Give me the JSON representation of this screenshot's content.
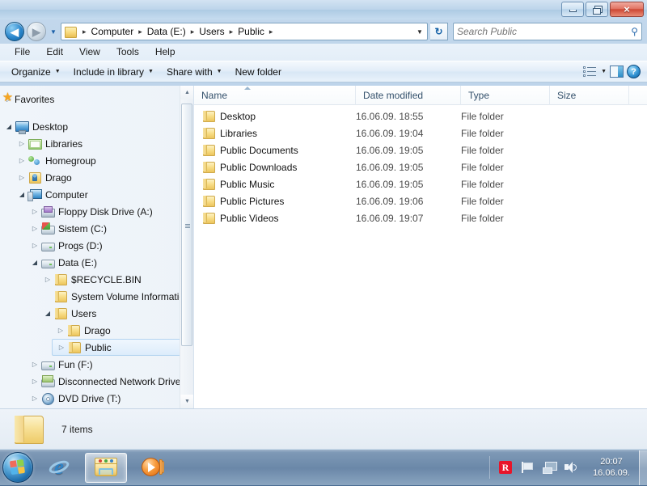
{
  "window": {
    "controls": {
      "minimize": "minimize-button",
      "maximize": "restore-button",
      "close": "×"
    }
  },
  "address": {
    "back_glyph": "◀",
    "forward_glyph": "▶",
    "history_glyph": "▼",
    "folder_icon": "folder-icon",
    "breadcrumbs": [
      "Computer",
      "Data (E:)",
      "Users",
      "Public"
    ],
    "separator": "▸",
    "dropdown_glyph": "▼",
    "refresh_glyph": "↻",
    "search_placeholder": "Search Public",
    "search_value": "",
    "search_icon": "search-icon"
  },
  "menubar": {
    "items": [
      "File",
      "Edit",
      "View",
      "Tools",
      "Help"
    ]
  },
  "toolbar": {
    "items": [
      {
        "label": "Organize",
        "has_caret": true
      },
      {
        "label": "Include in library",
        "has_caret": true
      },
      {
        "label": "Share with",
        "has_caret": true
      },
      {
        "label": "New folder",
        "has_caret": false
      }
    ],
    "caret_glyph": "▼",
    "view_icon": "view-options-icon",
    "layout_icon": "preview-pane-icon",
    "help_icon": "?"
  },
  "nav_pane": {
    "items": [
      {
        "label": "Favorites",
        "icon": "star-icon",
        "indent": 0,
        "expander": "collapsed",
        "selected": false,
        "spacer_after": true
      },
      {
        "label": "Desktop",
        "icon": "monitor-icon",
        "indent": 0,
        "expander": "expanded",
        "selected": false
      },
      {
        "label": "Libraries",
        "icon": "libraries-icon",
        "indent": 1,
        "expander": "collapsed",
        "selected": false
      },
      {
        "label": "Homegroup",
        "icon": "homegroup-icon",
        "indent": 1,
        "expander": "collapsed",
        "selected": false
      },
      {
        "label": "Drago",
        "icon": "user-folder-icon",
        "indent": 1,
        "expander": "collapsed",
        "selected": false
      },
      {
        "label": "Computer",
        "icon": "computer-icon",
        "indent": 1,
        "expander": "expanded",
        "selected": false
      },
      {
        "label": "Floppy Disk Drive (A:)",
        "icon": "floppy-drive-icon",
        "indent": 2,
        "expander": "collapsed",
        "selected": false
      },
      {
        "label": "Sistem (C:)",
        "icon": "system-drive-icon",
        "indent": 2,
        "expander": "collapsed",
        "selected": false
      },
      {
        "label": "Progs (D:)",
        "icon": "drive-icon",
        "indent": 2,
        "expander": "collapsed",
        "selected": false
      },
      {
        "label": "Data (E:)",
        "icon": "drive-icon",
        "indent": 2,
        "expander": "expanded",
        "selected": false
      },
      {
        "label": "$RECYCLE.BIN",
        "icon": "folder-icon",
        "indent": 3,
        "expander": "collapsed",
        "selected": false
      },
      {
        "label": "System Volume Information",
        "icon": "folder-icon",
        "indent": 3,
        "expander": "none",
        "selected": false
      },
      {
        "label": "Users",
        "icon": "folder-icon",
        "indent": 3,
        "expander": "expanded",
        "selected": false
      },
      {
        "label": "Drago",
        "icon": "folder-icon",
        "indent": 4,
        "expander": "collapsed",
        "selected": false
      },
      {
        "label": "Public",
        "icon": "folder-icon",
        "indent": 4,
        "expander": "collapsed",
        "selected": true
      },
      {
        "label": "Fun (F:)",
        "icon": "drive-icon",
        "indent": 2,
        "expander": "collapsed",
        "selected": false
      },
      {
        "label": "Disconnected Network Drive (S:)",
        "icon": "network-drive-icon",
        "indent": 2,
        "expander": "collapsed",
        "selected": false
      },
      {
        "label": "DVD Drive (T:)",
        "icon": "dvd-drive-icon",
        "indent": 2,
        "expander": "collapsed",
        "selected": false
      }
    ],
    "expander_collapsed_glyph": "▷",
    "expander_expanded_glyph": "◢",
    "scrollbar": {
      "up_glyph": "▲",
      "down_glyph": "▼"
    }
  },
  "file_list": {
    "columns": [
      "Name",
      "Date modified",
      "Type",
      "Size"
    ],
    "sort_column": "Name",
    "sort_direction": "ascending",
    "rows": [
      {
        "name": "Desktop",
        "date": "16.06.09. 18:55",
        "type": "File folder",
        "size": ""
      },
      {
        "name": "Libraries",
        "date": "16.06.09. 19:04",
        "type": "File folder",
        "size": ""
      },
      {
        "name": "Public Documents",
        "date": "16.06.09. 19:05",
        "type": "File folder",
        "size": ""
      },
      {
        "name": "Public Downloads",
        "date": "16.06.09. 19:05",
        "type": "File folder",
        "size": ""
      },
      {
        "name": "Public Music",
        "date": "16.06.09. 19:05",
        "type": "File folder",
        "size": ""
      },
      {
        "name": "Public Pictures",
        "date": "16.06.09. 19:06",
        "type": "File folder",
        "size": ""
      },
      {
        "name": "Public Videos",
        "date": "16.06.09. 19:07",
        "type": "File folder",
        "size": ""
      }
    ]
  },
  "details_pane": {
    "icon": "folder-icon",
    "text": "7 items"
  },
  "taskbar": {
    "start_button": "start-orb",
    "tasks": [
      {
        "name": "internet-explorer",
        "active": false
      },
      {
        "name": "windows-explorer",
        "active": true
      },
      {
        "name": "windows-media-player",
        "active": false
      }
    ],
    "tray_icons": [
      "avira-icon",
      "flag-icon",
      "network-icon",
      "volume-icon"
    ],
    "avira_glyph": "R",
    "clock_time": "20:07",
    "clock_date": "16.06.09."
  },
  "colors": {
    "accent": "#2a86cc",
    "selection": "#dcecfb",
    "folder_yellow": "#f8dd86",
    "taskbar": "#6c89a9",
    "close_red": "#cd4835"
  }
}
